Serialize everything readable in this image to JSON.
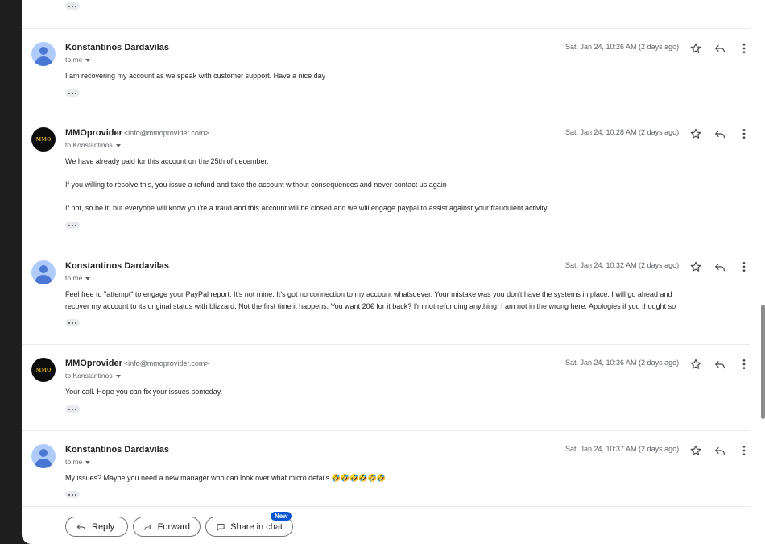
{
  "messages": [
    {
      "sender": "Konstantinos Dardavilas",
      "email": "",
      "recipient": "to me",
      "date": "Sat, Jan 24, 10:26 AM (2 days ago)",
      "avatar": "person",
      "lines": [
        "I am recovering my account as we speak with customer support. Have a nice day"
      ]
    },
    {
      "sender": "MMOprovider",
      "email": "<info@mmoprovider.com>",
      "recipient": "to Konstantinos",
      "date": "Sat, Jan 24, 10:28 AM (2 days ago)",
      "avatar": "logo",
      "lines": [
        "We have already paid for this account on the 25th of december.",
        "If you willing to resolve this, you issue a refund and take the account without consequences and never contact us again",
        "If not, so be it. but everyone will know you're a fraud and this account will be closed and we will engage paypal to assist against your fraudulent activity."
      ]
    },
    {
      "sender": "Konstantinos Dardavilas",
      "email": "",
      "recipient": "to me",
      "date": "Sat, Jan 24, 10:32 AM (2 days ago)",
      "avatar": "person",
      "lines": [
        "Feel free to \"attempt\" to engage your PayPal report. It's not mine. It's got no connection to my account whatsoever. Your mistake was you don't have the systems in place. I will go ahead and",
        "recover my account to its original status with blizzard. Not the first time it happens. You want 20€ for it back? I'm not refunding anything. I am not in the wrong here. Apologies if you thought so"
      ]
    },
    {
      "sender": "MMOprovider",
      "email": "<info@mmoprovider.com>",
      "recipient": "to Konstantinos",
      "date": "Sat, Jan 24, 10:36 AM (2 days ago)",
      "avatar": "logo",
      "lines": [
        "Your call. Hope you can fix your issues someday."
      ]
    },
    {
      "sender": "Konstantinos Dardavilas",
      "email": "",
      "recipient": "to me",
      "date": "Sat, Jan 24, 10:37 AM (2 days ago)",
      "avatar": "person",
      "lines": [
        "My issues? Maybe you need a new manager who can look over what micro details 🤣🤣🤣🤣🤣🤣"
      ]
    }
  ],
  "logo_text": "MMO",
  "actions": {
    "reply": "Reply",
    "forward": "Forward",
    "share": "Share in chat",
    "new_badge": "New"
  }
}
